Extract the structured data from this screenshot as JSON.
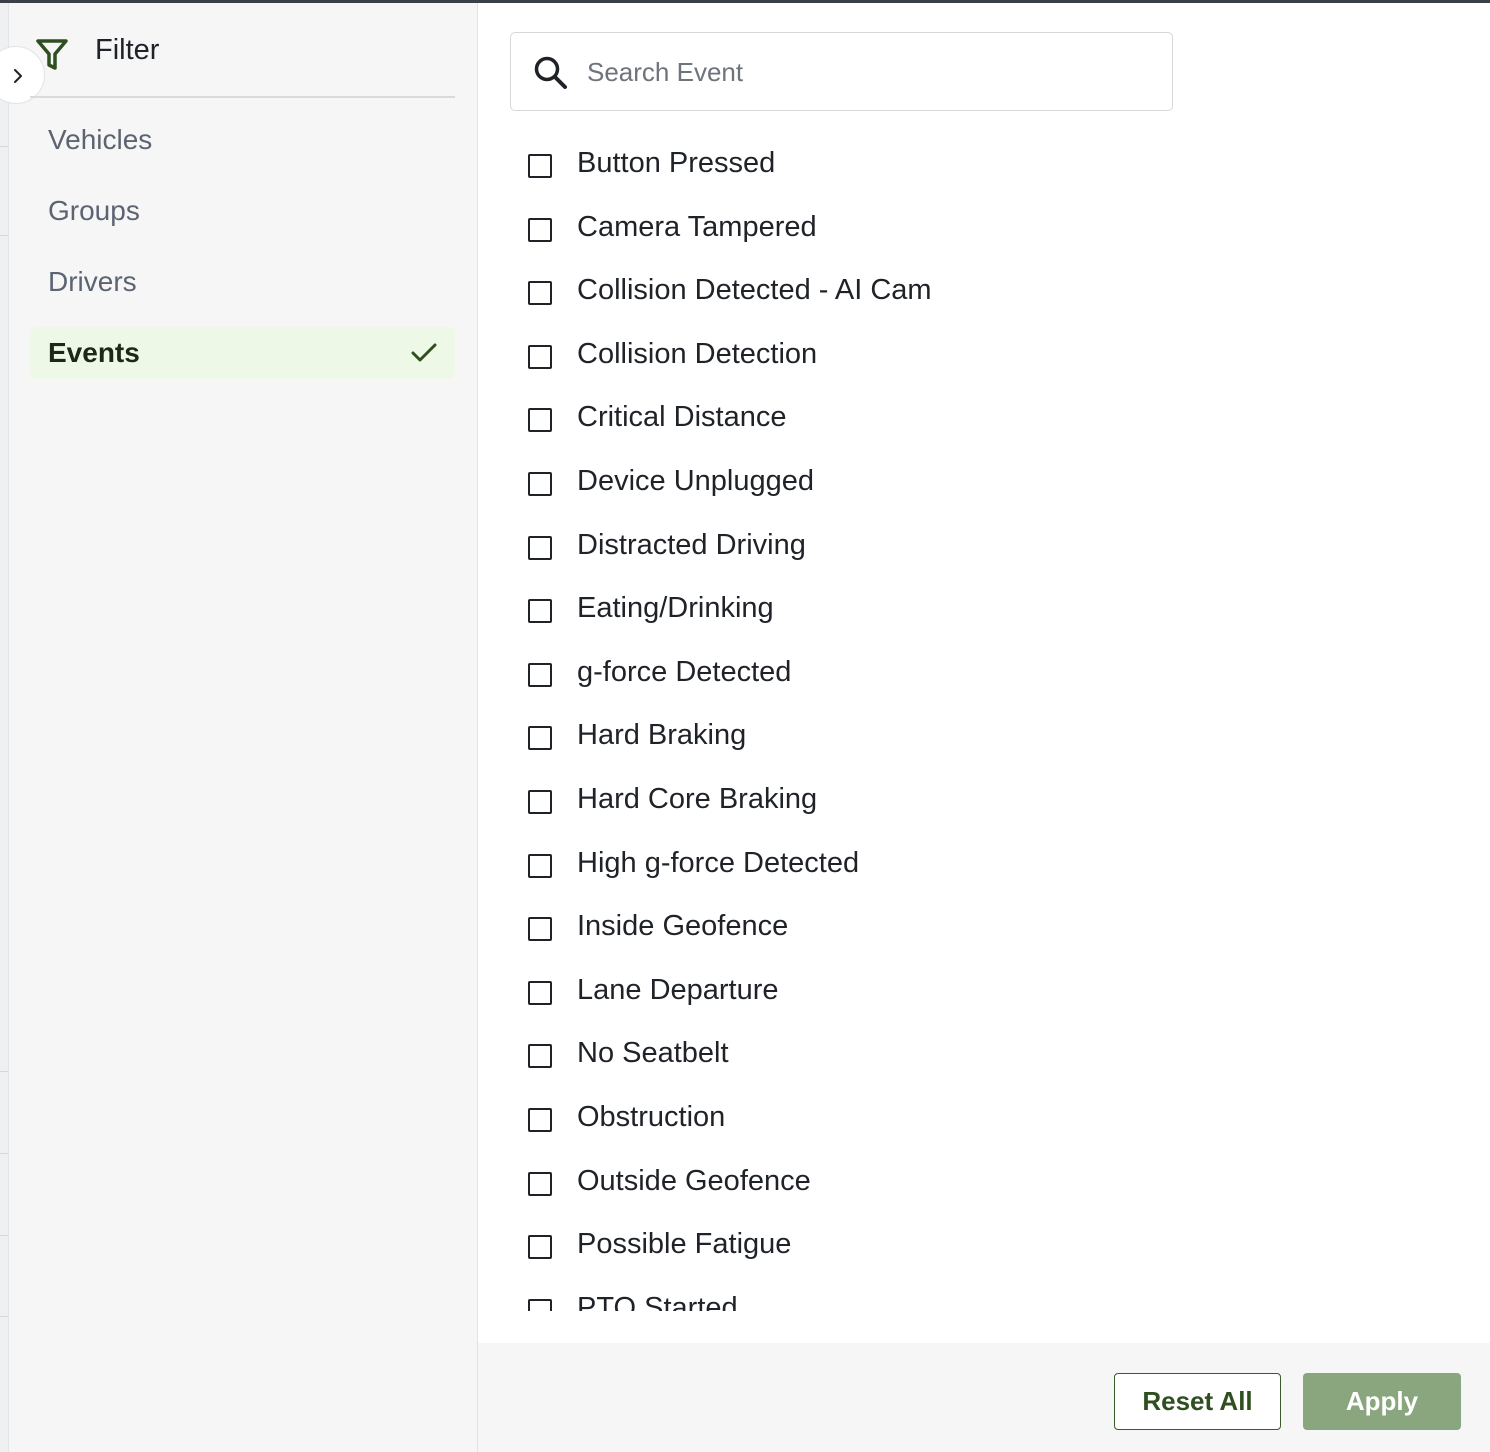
{
  "filter": {
    "title": "Filter",
    "icon": "filter-icon",
    "toggle_icon": "chevron-right-icon"
  },
  "sidebar": {
    "items": [
      {
        "label": "Vehicles",
        "active": false
      },
      {
        "label": "Groups",
        "active": false
      },
      {
        "label": "Drivers",
        "active": false
      },
      {
        "label": "Events",
        "active": true
      }
    ],
    "active_marker_icon": "checkmark-icon"
  },
  "search": {
    "placeholder": "Search Event",
    "value": "",
    "icon": "search-icon"
  },
  "events": [
    {
      "label": "Button Pressed",
      "checked": false
    },
    {
      "label": "Camera Tampered",
      "checked": false
    },
    {
      "label": "Collision Detected - AI Cam",
      "checked": false
    },
    {
      "label": "Collision Detection",
      "checked": false
    },
    {
      "label": "Critical Distance",
      "checked": false
    },
    {
      "label": "Device Unplugged",
      "checked": false
    },
    {
      "label": "Distracted Driving",
      "checked": false
    },
    {
      "label": "Eating/Drinking",
      "checked": false
    },
    {
      "label": "g-force Detected",
      "checked": false
    },
    {
      "label": "Hard Braking",
      "checked": false
    },
    {
      "label": "Hard Core Braking",
      "checked": false
    },
    {
      "label": "High g-force Detected",
      "checked": false
    },
    {
      "label": "Inside Geofence",
      "checked": false
    },
    {
      "label": "Lane Departure",
      "checked": false
    },
    {
      "label": "No Seatbelt",
      "checked": false
    },
    {
      "label": "Obstruction",
      "checked": false
    },
    {
      "label": "Outside Geofence",
      "checked": false
    },
    {
      "label": "Possible Fatigue",
      "checked": false
    },
    {
      "label": "PTO Started",
      "checked": false
    }
  ],
  "footer": {
    "reset_label": "Reset All",
    "apply_label": "Apply"
  },
  "colors": {
    "accent_green": "#3b5a2b",
    "apply_bg": "#8aa67e",
    "active_bg": "#eef8e6"
  }
}
